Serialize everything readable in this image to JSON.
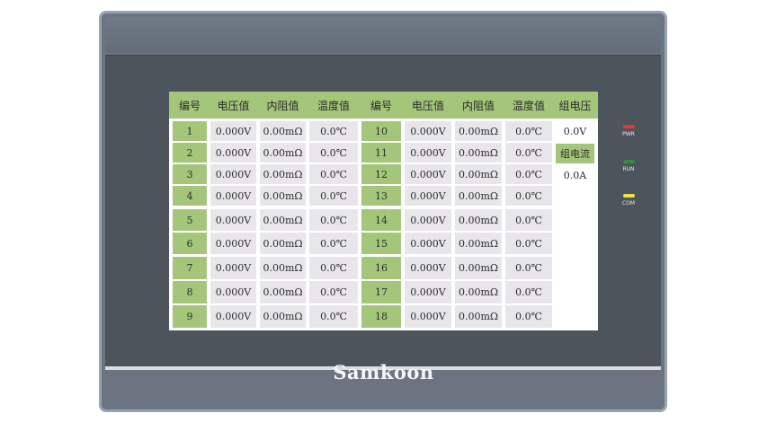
{
  "device": {
    "brand": "Samkoon",
    "leds": [
      {
        "label": "PWR",
        "color": "#e03a3a"
      },
      {
        "label": "RUN",
        "color": "#2f8f3a"
      },
      {
        "label": "COM",
        "color": "#f0e43a"
      }
    ]
  },
  "table": {
    "headers": [
      "编号",
      "电压值",
      "内阻值",
      "温度值",
      "编号",
      "电压值",
      "内阻值",
      "温度值",
      "组电压"
    ],
    "rows": [
      {
        "left": {
          "num": "1",
          "voltage": "0.000V",
          "resistance": "0.00mΩ",
          "temp": "0.0℃"
        },
        "right": {
          "num": "10",
          "voltage": "0.000V",
          "resistance": "0.00mΩ",
          "temp": "0.0℃"
        }
      },
      {
        "left": {
          "num": "2",
          "voltage": "0.000V",
          "resistance": "0.00mΩ",
          "temp": "0.0℃"
        },
        "right": {
          "num": "11",
          "voltage": "0.000V",
          "resistance": "0.00mΩ",
          "temp": "0.0℃"
        }
      },
      {
        "left": {
          "num": "3",
          "voltage": "0.000V",
          "resistance": "0.00mΩ",
          "temp": "0.0℃"
        },
        "right": {
          "num": "12",
          "voltage": "0.000V",
          "resistance": "0.00mΩ",
          "temp": "0.0℃"
        }
      },
      {
        "left": {
          "num": "4",
          "voltage": "0.000V",
          "resistance": "0.00mΩ",
          "temp": "0.0℃"
        },
        "right": {
          "num": "13",
          "voltage": "0.000V",
          "resistance": "0.00mΩ",
          "temp": "0.0℃"
        }
      },
      {
        "left": {
          "num": "5",
          "voltage": "0.000V",
          "resistance": "0.00mΩ",
          "temp": "0.0℃"
        },
        "right": {
          "num": "14",
          "voltage": "0.000V",
          "resistance": "0.00mΩ",
          "temp": "0.0℃"
        }
      },
      {
        "left": {
          "num": "6",
          "voltage": "0.000V",
          "resistance": "0.00mΩ",
          "temp": "0.0℃"
        },
        "right": {
          "num": "15",
          "voltage": "0.000V",
          "resistance": "0.00mΩ",
          "temp": "0.0℃"
        }
      },
      {
        "left": {
          "num": "7",
          "voltage": "0.000V",
          "resistance": "0.00mΩ",
          "temp": "0.0℃"
        },
        "right": {
          "num": "16",
          "voltage": "0.000V",
          "resistance": "0.00mΩ",
          "temp": "0.0℃"
        }
      },
      {
        "left": {
          "num": "8",
          "voltage": "0.000V",
          "resistance": "0.00mΩ",
          "temp": "0.0℃"
        },
        "right": {
          "num": "17",
          "voltage": "0.000V",
          "resistance": "0.00mΩ",
          "temp": "0.0℃"
        }
      },
      {
        "left": {
          "num": "9",
          "voltage": "0.000V",
          "resistance": "0.00mΩ",
          "temp": "0.0℃"
        },
        "right": {
          "num": "18",
          "voltage": "0.000V",
          "resistance": "0.00mΩ",
          "temp": "0.0℃"
        }
      }
    ]
  },
  "summary": {
    "group_voltage_value": "0.0V",
    "group_current_label": "组电流",
    "group_current_value": "0.0A"
  },
  "colors": {
    "header_green": "#a4c67a",
    "cell_gray": "#e8e6ea"
  }
}
